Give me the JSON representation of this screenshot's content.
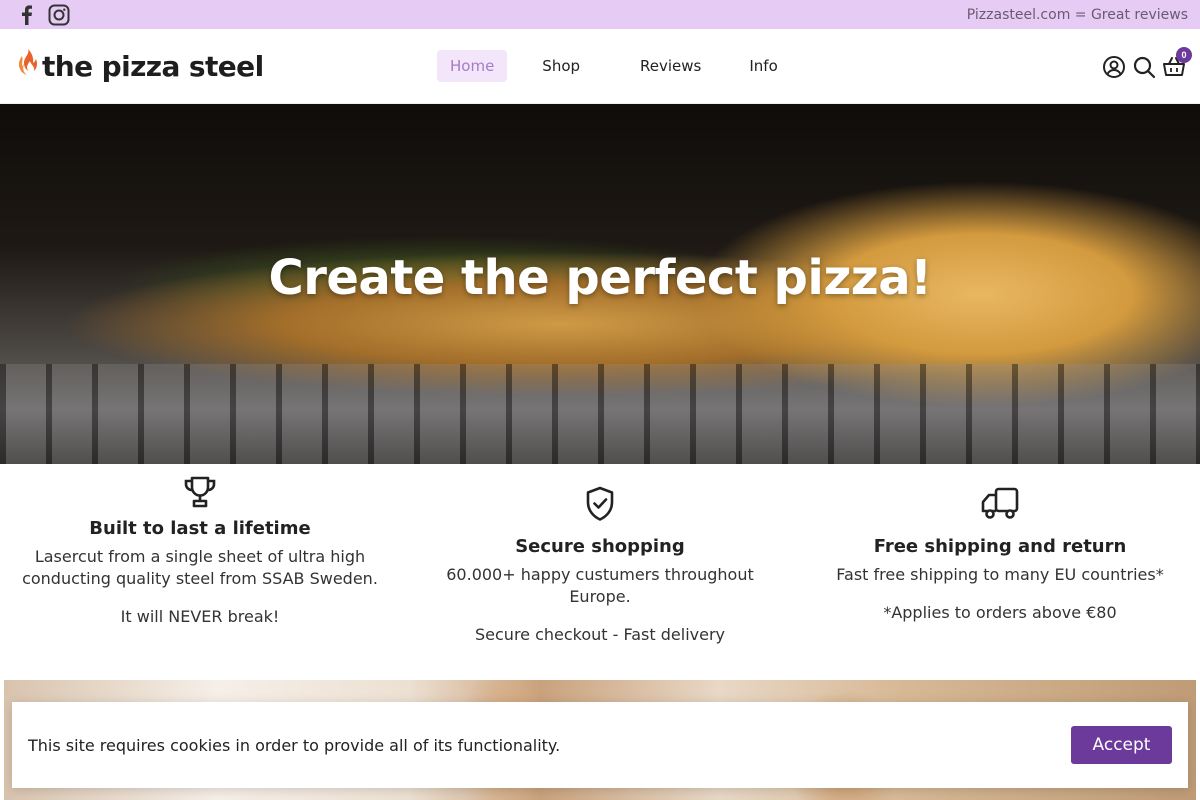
{
  "topbar": {
    "social": [
      "facebook-icon",
      "instagram-icon"
    ],
    "message": "Pizzasteel.com = Great reviews",
    "background": "#e6ccf5"
  },
  "header": {
    "logo_text": "the pizza steel",
    "nav": [
      {
        "label": "Home",
        "active": true
      },
      {
        "label": "Shop",
        "active": false
      },
      {
        "label": "Reviews",
        "active": false
      },
      {
        "label": "Info",
        "active": false
      }
    ],
    "icons": [
      "account-icon",
      "search-icon",
      "cart-icon"
    ],
    "cart_count": "0"
  },
  "hero": {
    "title": "Create the perfect pizza!"
  },
  "features": [
    {
      "icon": "trophy-icon",
      "title": "Built to last a lifetime",
      "text": "Lasercut from a single sheet of ultra high conducting quality steel from SSAB Sweden.",
      "text2": "It will NEVER break!"
    },
    {
      "icon": "shield-check-icon",
      "title": "Secure shopping",
      "text": "60.000+ happy custumers throughout Europe.",
      "text2": "Secure checkout - Fast delivery"
    },
    {
      "icon": "truck-icon",
      "title": "Free shipping and return",
      "text": "Fast free shipping to many EU countries*",
      "text2": "*Applies to orders above €80"
    }
  ],
  "cookie": {
    "text": "This site requires cookies in order to provide all of its functionality.",
    "accept_label": "Accept"
  },
  "colors": {
    "accent": "#6b3a9a",
    "nav_active_bg": "#f3e6fb",
    "nav_active_text": "#a67cc6",
    "logo_flame": "#e8622a"
  }
}
